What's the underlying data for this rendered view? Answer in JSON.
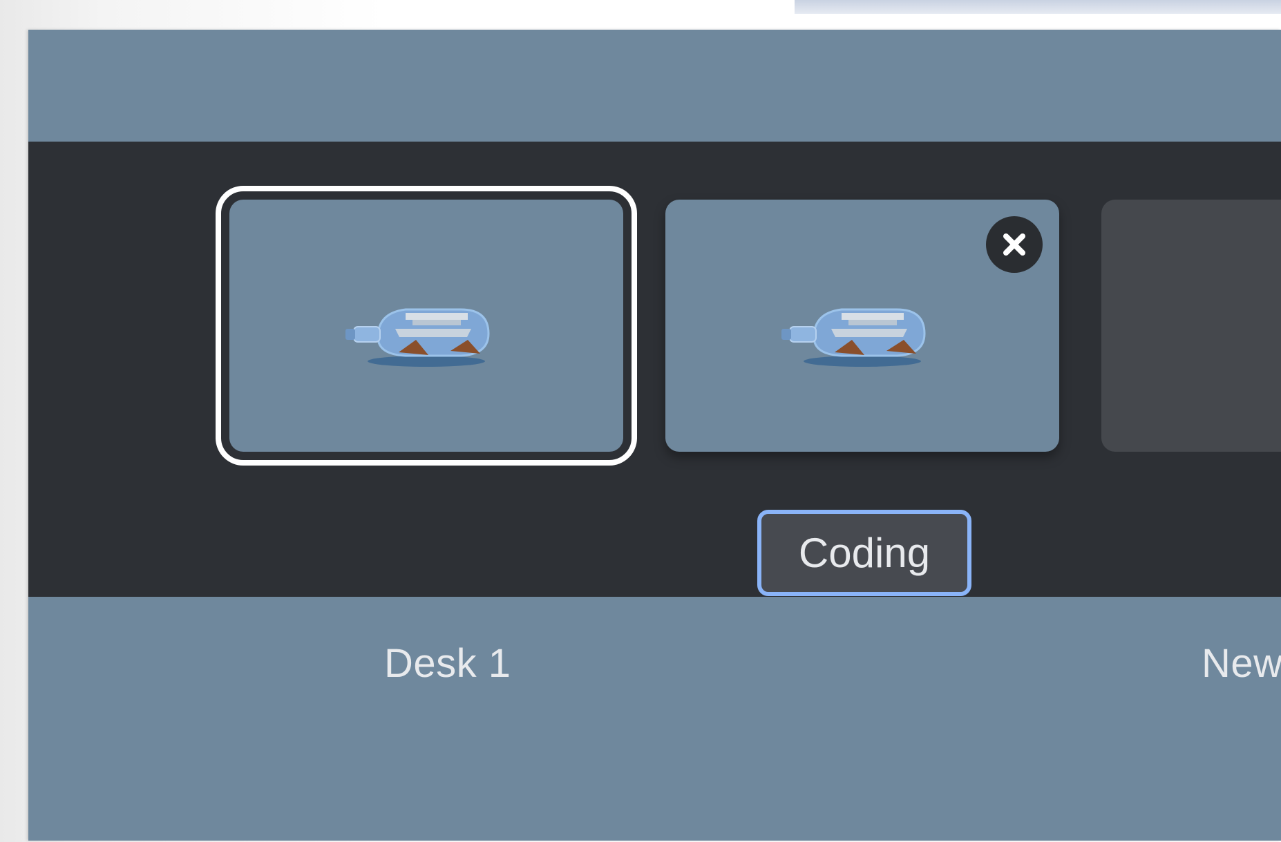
{
  "desks": [
    {
      "label": "Desk 1",
      "active": true,
      "wallpaper_icon": "ship-in-bottle-icon"
    },
    {
      "label": "Coding",
      "editing": true,
      "wallpaper_icon": "ship-in-bottle-icon",
      "close_icon": "close-icon"
    },
    {
      "label": "New",
      "new_desk": true
    }
  ],
  "colors": {
    "wallpaper": "#6f889d",
    "bar": "#2d3035",
    "focus_ring": "#8ab4f8",
    "active_outline": "#ffffff"
  }
}
